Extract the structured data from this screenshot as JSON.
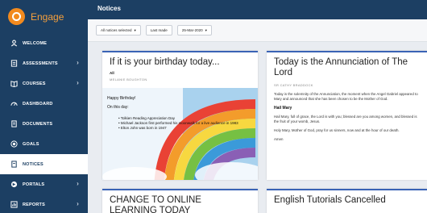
{
  "app": {
    "name": "Engage"
  },
  "sidebar": {
    "items": [
      {
        "label": "WELCOME",
        "icon": "user-icon",
        "chevron": false
      },
      {
        "label": "ASSESSMENTS",
        "icon": "clipboard-icon",
        "chevron": true
      },
      {
        "label": "COURSES",
        "icon": "book-icon",
        "chevron": true
      },
      {
        "label": "DASHBOARD",
        "icon": "gauge-icon",
        "chevron": false
      },
      {
        "label": "DOCUMENTS",
        "icon": "folder-icon",
        "chevron": false
      },
      {
        "label": "GOALS",
        "icon": "target-icon",
        "chevron": false
      },
      {
        "label": "NOTICES",
        "icon": "notice-icon",
        "chevron": false,
        "active": true
      },
      {
        "label": "PORTALS",
        "icon": "globe-icon",
        "chevron": true
      },
      {
        "label": "REPORTS",
        "icon": "report-icon",
        "chevron": true
      }
    ]
  },
  "header": {
    "title": "Notices"
  },
  "filters": {
    "filter1": "All notices selected",
    "filter2": "Last made",
    "filter3": "25-Mar-2020"
  },
  "cards": {
    "birthday": {
      "title": "If it is your birthday today...",
      "audience": "All",
      "author": "MELANIE BOUGHTON",
      "greeting": "Happy Birthday!",
      "intro": "On this day:",
      "facts": [
        "Tolkien Reading Appreciation Day",
        "Michael Jackson first performed his moonwalk for a live audience in 1983",
        "Elton John was born in 1947"
      ]
    },
    "annunciation": {
      "title": "Today is the Annunciation of The Lord",
      "author": "SR CATHY BRADDOCK",
      "body1": "Today is the solemnity of the Annunciation, the moment when the Angel Gabriel appeared to Mary and announced that she has been chosen to be the Mother of God.",
      "heading": "Hail Mary",
      "body2": "Hail Mary, full of grace, the Lord is with you; blessed are you among women, and blessed is the fruit of your womb, Jesus.",
      "body3": "Holy Mary, Mother of God, pray for us sinners, now and at the hour of our death.",
      "amen": "Amen"
    },
    "online": {
      "title": "CHANGE TO ONLINE LEARNING TODAY"
    },
    "tutorials": {
      "title": "English Tutorials Cancelled"
    }
  },
  "colors": {
    "sidebar": "#1c3f63",
    "accent": "#f28a1e",
    "card_border": "#3a63b5"
  }
}
